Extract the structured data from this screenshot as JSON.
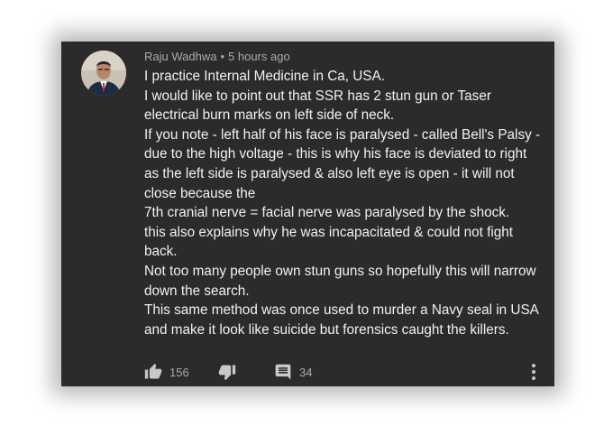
{
  "comment": {
    "author": "Raju Wadhwa",
    "separator": "•",
    "time": "5 hours ago",
    "lines": [
      "I practice Internal Medicine in Ca, USA.",
      "I would like to point out that SSR has 2 stun gun or Taser",
      "electrical burn marks on left side of neck.",
      "If you note - left half of his face is paralysed - called Bell's Palsy -",
      "due to the high voltage - this is why his face is deviated to right",
      "as the left side is paralysed & also left eye is open - it will not",
      "close because the",
      "7th cranial nerve = facial nerve was paralysed by the shock.",
      "this also explains why he was incapacitated & could not fight",
      "back.",
      "Not too many people own stun guns so hopefully this will narrow",
      "down the search.",
      "This same method was once used to murder a Navy seal in USA",
      "and make it look like suicide but forensics caught the killers."
    ]
  },
  "actions": {
    "like_icon": "thumbs-up-icon",
    "like_count": "156",
    "dislike_icon": "thumbs-down-icon",
    "reply_icon": "reply-comment-icon",
    "reply_count": "34",
    "more_icon": "more-vertical-icon"
  },
  "colors": {
    "card_background": "#2b2b2b",
    "text_primary": "#f1f1f1",
    "text_secondary": "#aaaaaa"
  }
}
